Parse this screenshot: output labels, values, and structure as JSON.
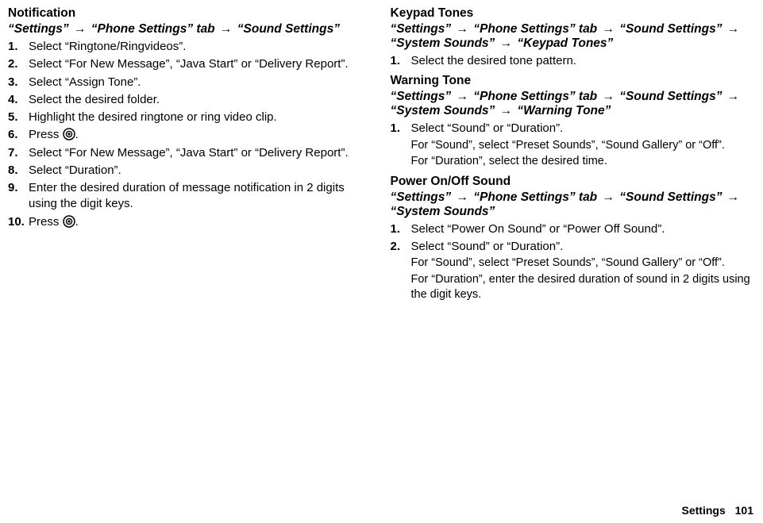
{
  "left": {
    "title": "Notification",
    "breadcrumb": [
      "“Settings”",
      "“Phone Settings” tab",
      "“Sound Settings”"
    ],
    "steps": [
      {
        "n": "1.",
        "text": "Select “Ringtone/Ringvideos”."
      },
      {
        "n": "2.",
        "text": "Select “For New Message”, “Java Start” or “Delivery Report”."
      },
      {
        "n": "3.",
        "text": "Select “Assign Tone”."
      },
      {
        "n": "4.",
        "text": "Select the desired folder."
      },
      {
        "n": "5.",
        "text": "Highlight the desired ringtone or ring video clip."
      },
      {
        "n": "6.",
        "pre": "Press ",
        "icon": true,
        "post": "."
      },
      {
        "n": "7.",
        "text": "Select “For New Message”, “Java Start” or “Delivery Report”."
      },
      {
        "n": "8.",
        "text": "Select “Duration”."
      },
      {
        "n": "9.",
        "text": "Enter the desired duration of message notification in 2 digits using the digit keys."
      },
      {
        "n": "10.",
        "pre": "Press ",
        "icon": true,
        "post": "."
      }
    ]
  },
  "right": {
    "sections": [
      {
        "title": "Keypad Tones",
        "breadcrumb": [
          "“Settings”",
          "“Phone Settings” tab",
          "“Sound Settings”",
          "“System Sounds”",
          "“Keypad Tones”"
        ],
        "steps": [
          {
            "n": "1.",
            "text": "Select the desired tone pattern."
          }
        ]
      },
      {
        "title": "Warning Tone",
        "breadcrumb": [
          "“Settings”",
          "“Phone Settings” tab",
          "“Sound Settings”",
          "“System Sounds”",
          "“Warning Tone”"
        ],
        "steps": [
          {
            "n": "1.",
            "text": "Select “Sound” or “Duration”.",
            "subs": [
              "For “Sound”, select “Preset Sounds”, “Sound Gallery” or “Off”.",
              "For “Duration”, select the desired time."
            ]
          }
        ]
      },
      {
        "title": "Power On/Off Sound",
        "breadcrumb": [
          "“Settings”",
          "“Phone Settings” tab",
          "“Sound Settings”",
          "“System Sounds”"
        ],
        "steps": [
          {
            "n": "1.",
            "text": "Select “Power On Sound” or “Power Off Sound”."
          },
          {
            "n": "2.",
            "text": "Select “Sound” or “Duration”.",
            "subs": [
              "For “Sound”, select “Preset Sounds”, “Sound Gallery” or “Off”.",
              "For “Duration”, enter the desired duration of sound in 2 digits using the digit keys."
            ]
          }
        ]
      }
    ]
  },
  "footer": {
    "section": "Settings",
    "page": "101"
  }
}
